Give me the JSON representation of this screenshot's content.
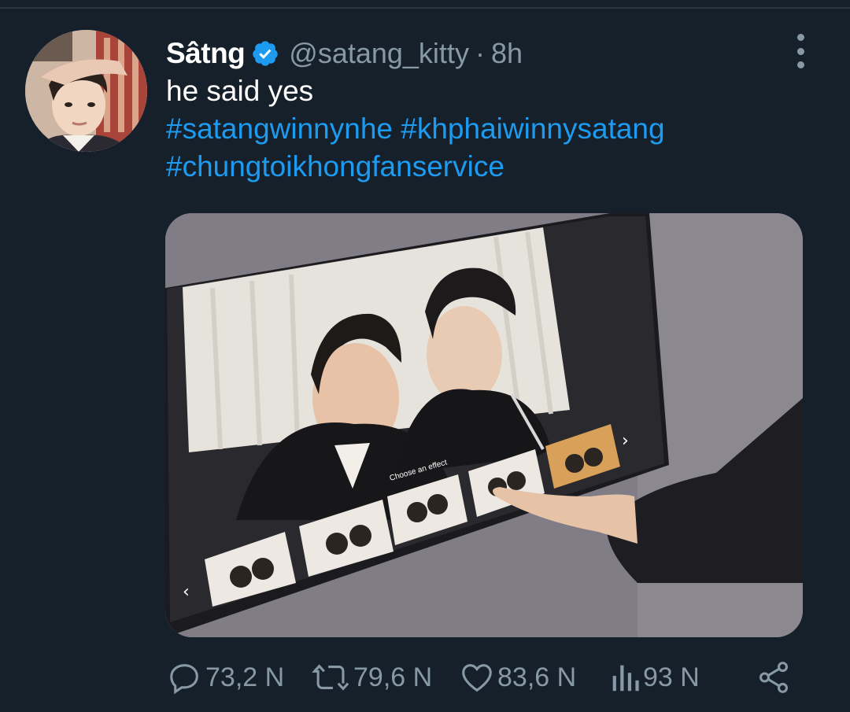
{
  "tweet": {
    "display_name": "Sâtng",
    "handle": "@satang_kitty",
    "separator": "·",
    "time": "8h",
    "text": "he said yes",
    "hashtags": [
      "#satangwinnynhe",
      "#khphaiwinnysatang",
      "#chungtoikhongfanservice"
    ],
    "media_overlay": {
      "choose_effect_label": "Choose an effect",
      "prev_arrow": "‹",
      "next_arrow": "›"
    }
  },
  "actions": {
    "replies": "73,2 N",
    "retweets": "79,6 N",
    "likes": "83,6 N",
    "views": "93 N"
  },
  "icons": {
    "verified": "verified-badge-icon",
    "more": "more-vertical-icon",
    "reply": "comment-bubble-icon",
    "retweet": "retweet-icon",
    "like": "heart-icon",
    "views": "analytics-bars-icon",
    "share": "share-icon"
  },
  "colors": {
    "background": "#15202b",
    "text_primary": "#ffffff",
    "text_secondary": "#8899a6",
    "link": "#1d9bf0",
    "verified": "#1d9bf0"
  }
}
